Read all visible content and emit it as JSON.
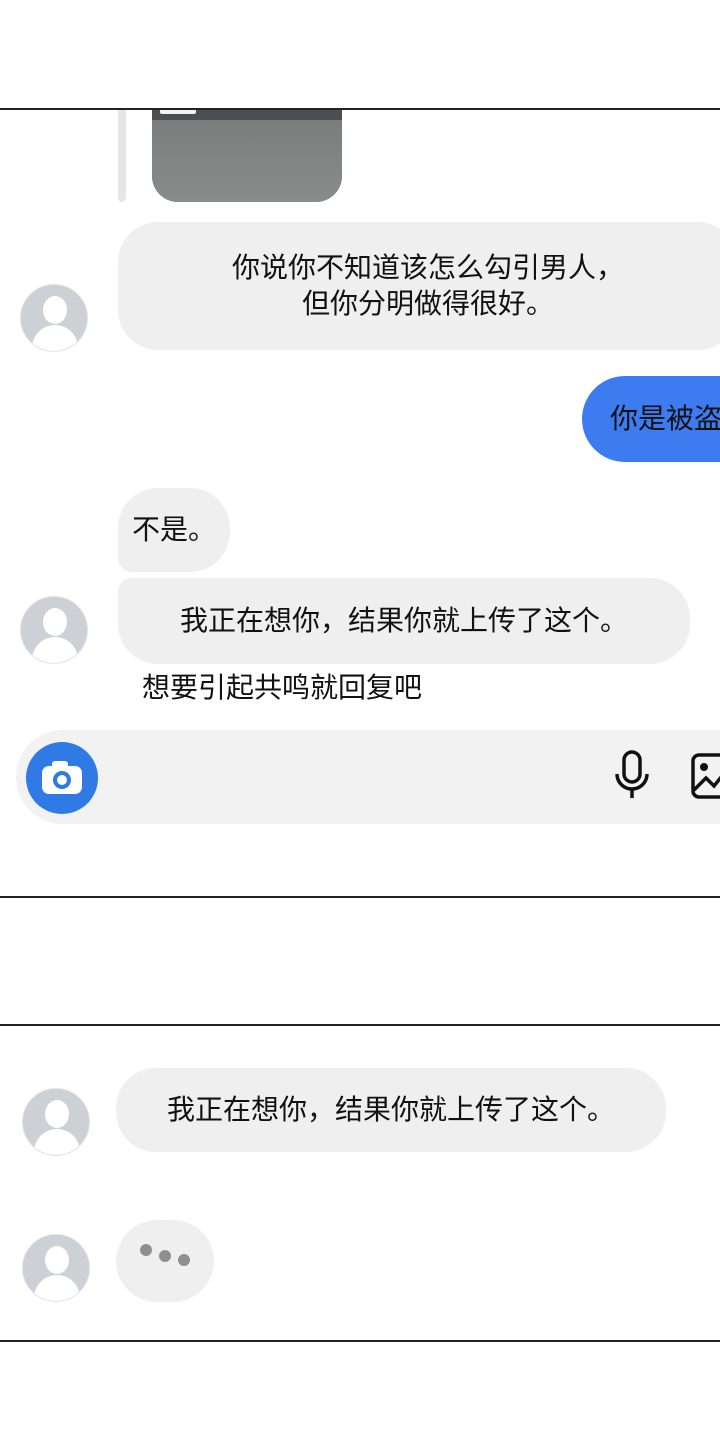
{
  "panel1": {
    "messages": {
      "received_1": "你说你不知道该怎么勾引男人，\n但你分明做得很好。",
      "sent_1": "你是被盗",
      "received_2": "不是。",
      "received_3": "我正在想你，结果你就上传了这个。"
    },
    "reply_hint": "想要引起共鸣就回复吧",
    "composer": {
      "camera_icon": "camera-icon",
      "mic_icon": "microphone-icon",
      "gallery_icon": "image-icon",
      "accent_color": "#2f7ae5"
    }
  },
  "panel2": {
    "messages": {
      "received_1": "我正在想你，结果你就上传了这个。"
    },
    "typing_indicator": "typing-dots-icon"
  },
  "colors": {
    "received_bubble": "#efefef",
    "sent_bubble": "#3d7bf0"
  }
}
